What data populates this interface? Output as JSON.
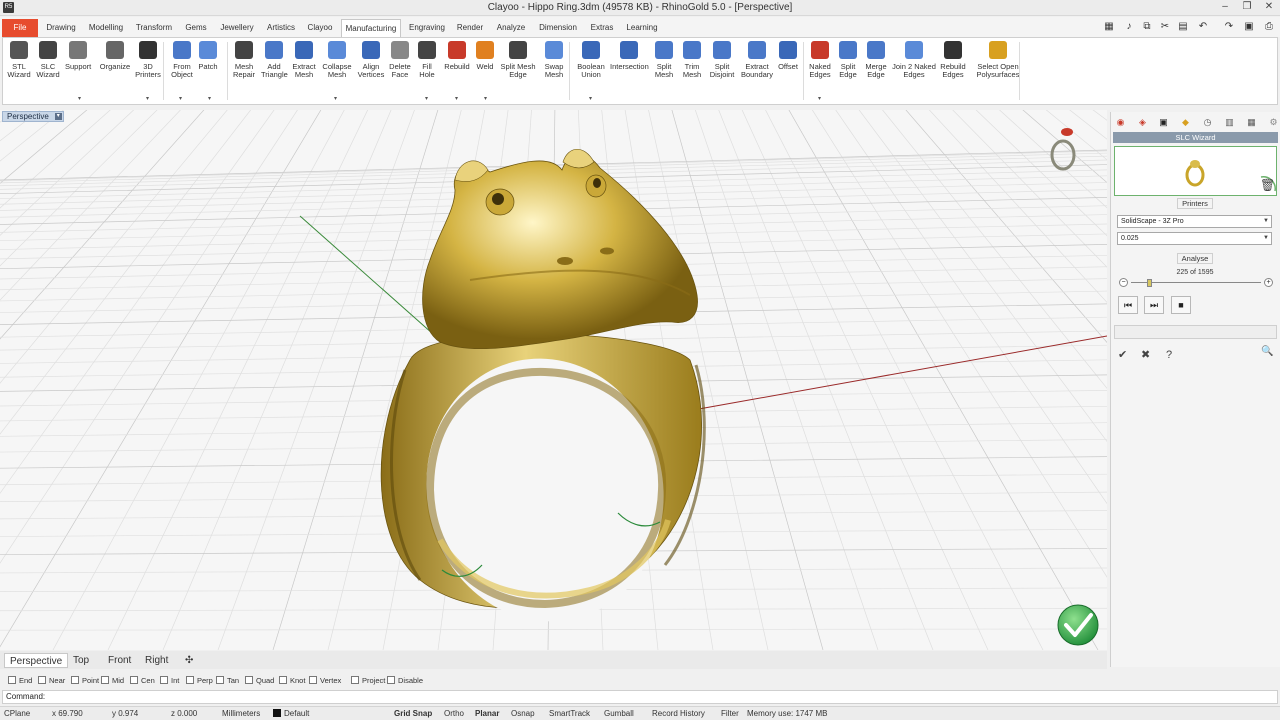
{
  "window": {
    "title": "Clayoo - Hippo Ring.3dm (49578 KB) - RhinoGold 5.0 - [Perspective]",
    "app_icon": "R5",
    "controls": [
      "‒",
      "❐",
      "✕"
    ]
  },
  "tabs": [
    "File",
    "Drawing",
    "Modelling",
    "Transform",
    "Gems",
    "Jewellery",
    "Artistics",
    "Clayoo",
    "Manufacturing",
    "Engraving",
    "Render",
    "Analyze",
    "Dimension",
    "Extras",
    "Learning"
  ],
  "active_tab": "Manufacturing",
  "quick_access": [
    "tool-icon",
    "mic-icon",
    "copy-icon",
    "cut-icon",
    "paste-icon",
    "undo-icon",
    "redo-icon",
    "save-icon",
    "print-icon"
  ],
  "ribbon": {
    "buttons": [
      {
        "label": "STL\nWizard",
        "color": "#555"
      },
      {
        "label": "SLC\nWizard",
        "color": "#444"
      },
      {
        "label": "Support",
        "color": "#777"
      },
      {
        "label": "Organize",
        "color": "#666"
      },
      {
        "label": "3D\nPrinters",
        "color": "#333"
      },
      {
        "label": "From\nObject",
        "color": "#4a78c8"
      },
      {
        "label": "Patch",
        "color": "#5a8ad8"
      },
      {
        "label": "Mesh\nRepair",
        "color": "#444"
      },
      {
        "label": "Add\nTriangle",
        "color": "#4a78c8"
      },
      {
        "label": "Extract\nMesh",
        "color": "#3a68b8"
      },
      {
        "label": "Collapse\nMesh",
        "color": "#5a8ad8"
      },
      {
        "label": "Align\nVertices",
        "color": "#3a68b8"
      },
      {
        "label": "Delete\nFace",
        "color": "#888"
      },
      {
        "label": "Fill\nHole",
        "color": "#444"
      },
      {
        "label": "Rebuild",
        "color": "#c83a2a"
      },
      {
        "label": "Weld",
        "color": "#e08020"
      },
      {
        "label": "Split Mesh\nEdge",
        "color": "#444"
      },
      {
        "label": "Swap\nMesh",
        "color": "#5a8ad8"
      },
      {
        "label": "Boolean\nUnion",
        "color": "#3a68b8"
      },
      {
        "label": "Intersection",
        "color": "#3a68b8"
      },
      {
        "label": "Split\nMesh",
        "color": "#4a78c8"
      },
      {
        "label": "Trim\nMesh",
        "color": "#4a78c8"
      },
      {
        "label": "Split\nDisjoint",
        "color": "#4a78c8"
      },
      {
        "label": "Extract\nBoundary",
        "color": "#4a78c8"
      },
      {
        "label": "Offset",
        "color": "#3a68b8"
      },
      {
        "label": "Naked\nEdges",
        "color": "#c83a2a"
      },
      {
        "label": "Split\nEdge",
        "color": "#4a78c8"
      },
      {
        "label": "Merge\nEdge",
        "color": "#4a78c8"
      },
      {
        "label": "Join 2 Naked\nEdges",
        "color": "#5a8ad8"
      },
      {
        "label": "Rebuild\nEdges",
        "color": "#333"
      },
      {
        "label": "Select Open\nPolysurfaces",
        "color": "#d8a020"
      }
    ]
  },
  "viewport": {
    "label": "Perspective",
    "dropdown": "▾"
  },
  "viewport_tabs": [
    "Perspective",
    "Top",
    "Front",
    "Right",
    "✣"
  ],
  "osnap": [
    "End",
    "Near",
    "Point",
    "Mid",
    "Cen",
    "Int",
    "Perp",
    "Tan",
    "Quad",
    "Knot",
    "Vertex",
    "Project",
    "Disable"
  ],
  "command": {
    "label": "Command:"
  },
  "status": {
    "cplane": "CPlane",
    "x": "x 69.790",
    "y": "y 0.974",
    "z": "z 0.000",
    "units": "Millimeters",
    "layer": "Default",
    "grid_snap": "Grid Snap",
    "ortho": "Ortho",
    "planar": "Planar",
    "osnap": "Osnap",
    "smarttrack": "SmartTrack",
    "gumball": "Gumball",
    "record_history": "Record History",
    "filter": "Filter",
    "memory": "Memory use: 1747 MB"
  },
  "panel": {
    "title": "SLC Wizard",
    "printers_label": "Printers",
    "printer_value": "SolidScape - 3Z Pro",
    "layer_value": "0.025",
    "analyse_label": "Analyse",
    "progress_text": "225 of 1595",
    "progress_fraction": 0.141,
    "delete_icon": "trash-icon",
    "accept_icon": "✔",
    "cancel_icon": "✖",
    "help_icon": "?",
    "search_icon": "🔍"
  },
  "colors": {
    "gold_light": "#f7e7a0",
    "gold_mid": "#c9a52a",
    "gold_dark": "#6a5410",
    "file_tab": "#e74c2e",
    "confirm_green": "#2ea84a"
  }
}
